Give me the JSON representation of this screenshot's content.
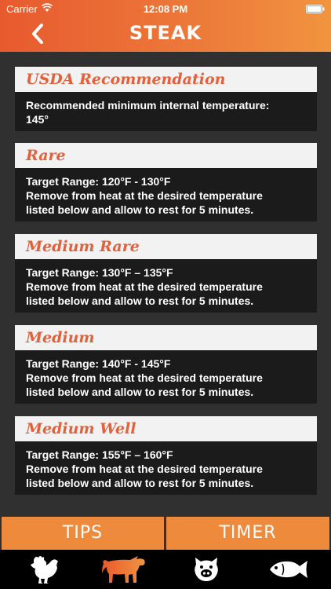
{
  "status": {
    "carrier": "Carrier",
    "time": "12:08 PM"
  },
  "nav": {
    "title": "STEAK"
  },
  "cards": [
    {
      "heading": "USDA Recommendation",
      "lines": [
        "Recommended minimum internal temperature:",
        "145°"
      ]
    },
    {
      "heading": "Rare",
      "lines": [
        "Target Range: 120°F - 130°F",
        "Remove from heat at the desired temperature",
        "listed below and allow to rest for 5 minutes."
      ]
    },
    {
      "heading": "Medium Rare",
      "lines": [
        "Target Range: 130°F – 135°F",
        "Remove from heat at the desired temperature",
        "listed below and allow to rest for 5 minutes."
      ]
    },
    {
      "heading": "Medium",
      "lines": [
        "Target Range: 140°F - 145°F",
        "Remove from heat at the desired temperature",
        "listed below and allow to rest for 5 minutes."
      ]
    },
    {
      "heading": "Medium Well",
      "lines": [
        "Target Range: 155°F – 160°F",
        "Remove from heat at the desired temperature",
        "listed below and allow to rest for 5 minutes."
      ]
    }
  ],
  "buttons": {
    "tips": "TIPS",
    "timer": "TIMER"
  },
  "tabs": [
    {
      "icon": "chicken-icon",
      "active": false
    },
    {
      "icon": "cow-icon",
      "active": true
    },
    {
      "icon": "pig-icon",
      "active": false
    },
    {
      "icon": "fish-icon",
      "active": false
    }
  ],
  "colors": {
    "accent": "#e85a2e",
    "accent_end": "#f1943f",
    "heading_text": "#e2603a",
    "background": "#303030",
    "card_body": "#1b1b1b"
  }
}
